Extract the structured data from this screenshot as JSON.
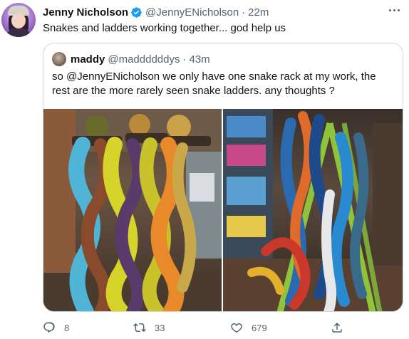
{
  "tweet": {
    "author_name": "Jenny Nicholson",
    "author_handle": "@JennyENicholson",
    "separator": "·",
    "time": "22m",
    "text": "Snakes and ladders working together... god help us",
    "verified_color": "#1d9bf0"
  },
  "quote": {
    "author_name": "maddy",
    "author_handle": "@maddddddys",
    "separator": "·",
    "time": "43m",
    "text": "so @JennyENicholson we only have one snake rack at my work, the rest are the more rarely seen snake ladders. any thoughts ?",
    "photos": [
      {
        "name": "snake-rack-photo"
      },
      {
        "name": "snake-ladder-photo"
      }
    ]
  },
  "actions": {
    "replies": "8",
    "retweets": "33",
    "likes": "679"
  },
  "colors": {
    "text": "#0f1419",
    "secondary": "#536471",
    "border": "#cfd9de",
    "accent": "#1d9bf0"
  }
}
